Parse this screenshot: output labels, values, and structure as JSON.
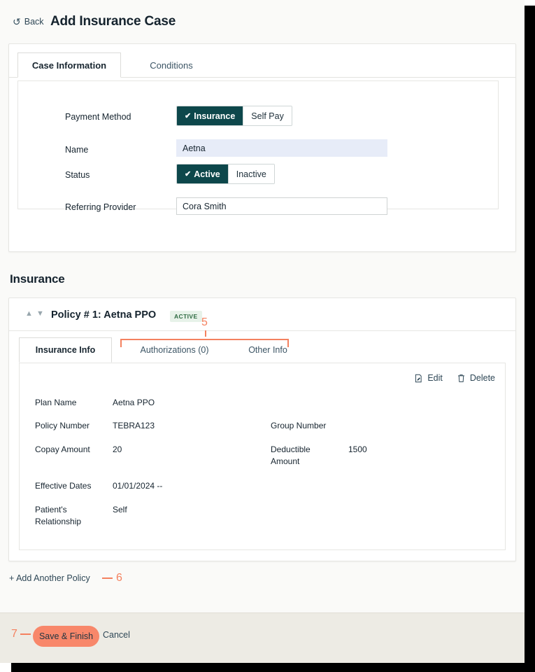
{
  "header": {
    "back_label": "Back",
    "back_icon": "undo-arrow-icon",
    "title": "Add Insurance Case"
  },
  "case_card": {
    "tabs": [
      {
        "label": "Case Information",
        "active": true
      },
      {
        "label": "Conditions",
        "active": false
      }
    ],
    "fields": {
      "payment_method": {
        "label": "Payment Method",
        "options": [
          "Insurance",
          "Self Pay"
        ],
        "selected": "Insurance",
        "check_glyph": "✔"
      },
      "name": {
        "label": "Name",
        "value": "Aetna"
      },
      "status": {
        "label": "Status",
        "options": [
          "Active",
          "Inactive"
        ],
        "selected": "Active",
        "check_glyph": "✔"
      },
      "referring_provider": {
        "label": "Referring Provider",
        "value": "Cora Smith"
      }
    }
  },
  "insurance": {
    "section_title": "Insurance",
    "policy": {
      "collapse_up_icon": "chevron-up-icon",
      "collapse_down_icon": "chevron-down-icon",
      "title": "Policy # 1: Aetna PPO",
      "status_badge": "ACTIVE",
      "tabs": [
        {
          "label": "Insurance Info",
          "active": true
        },
        {
          "label": "Authorizations (0)",
          "active": false
        },
        {
          "label": "Other Info",
          "active": false
        }
      ],
      "actions": {
        "edit_label": "Edit",
        "edit_icon": "edit-document-icon",
        "delete_label": "Delete",
        "delete_icon": "trash-icon"
      },
      "details": {
        "plan_name_label": "Plan Name",
        "plan_name_value": "Aetna PPO",
        "policy_number_label": "Policy Number",
        "policy_number_value": "TEBRA123",
        "group_number_label": "Group Number",
        "group_number_value": "",
        "copay_label": "Copay Amount",
        "copay_value": "20",
        "deductible_label": "Deductible Amount",
        "deductible_value": "1500",
        "effective_dates_label": "Effective Dates",
        "effective_dates_value": "01/01/2024 --",
        "relationship_label": "Patient's Relationship",
        "relationship_value": "Self"
      }
    },
    "add_policy_label": "+ Add Another Policy"
  },
  "footer": {
    "save_label": "Save & Finish",
    "cancel_label": "Cancel"
  },
  "annotations": {
    "tabs_marker": "5",
    "add_policy_marker": "6",
    "save_marker": "7"
  },
  "colors": {
    "accent_dark_teal": "#0d474b",
    "annotation_orange": "#f4815f",
    "save_button": "#f8876a",
    "badge_bg": "#e7f2e9",
    "badge_text": "#2f6b42",
    "name_field_bg": "#e7ecf8",
    "page_bg": "#fafaf8",
    "footer_bg": "#edebe4"
  }
}
